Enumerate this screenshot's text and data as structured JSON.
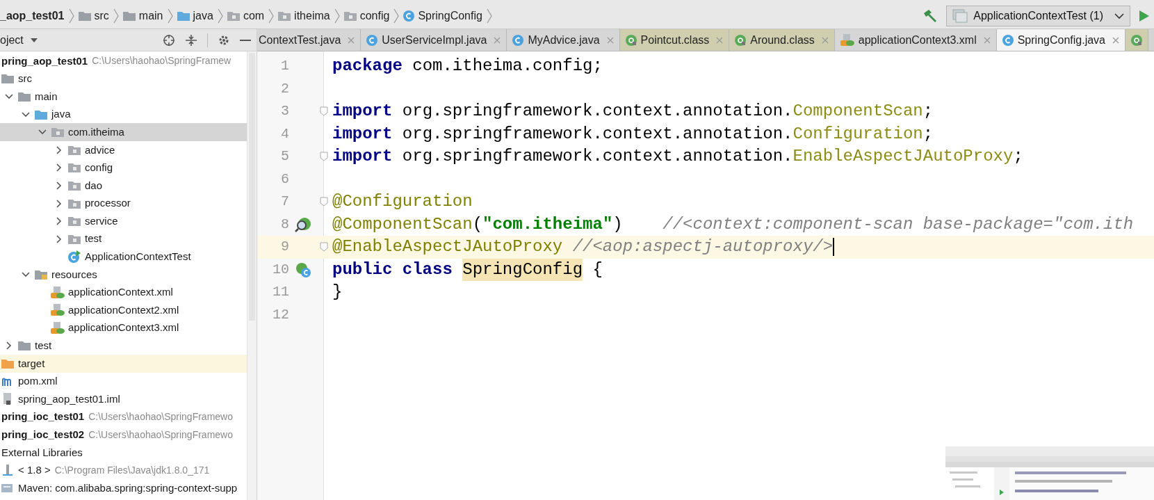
{
  "breadcrumbs": [
    {
      "label": "_aop_test01",
      "kind": "module"
    },
    {
      "label": "src",
      "kind": "folder"
    },
    {
      "label": "main",
      "kind": "folder"
    },
    {
      "label": "java",
      "kind": "source-folder"
    },
    {
      "label": "com",
      "kind": "package"
    },
    {
      "label": "itheima",
      "kind": "package"
    },
    {
      "label": "config",
      "kind": "package"
    },
    {
      "label": "SpringConfig",
      "kind": "class"
    }
  ],
  "run_config": {
    "label": "ApplicationContextTest (1)"
  },
  "project_panel": {
    "title": "oject"
  },
  "tabs": [
    {
      "label": "ContextTest.java",
      "kind": "text",
      "selected": false
    },
    {
      "label": "UserServiceImpl.java",
      "kind": "class",
      "selected": false
    },
    {
      "label": "MyAdvice.java",
      "kind": "class",
      "selected": false
    },
    {
      "label": "Pointcut.class",
      "kind": "compiled-annotation",
      "selected": false
    },
    {
      "label": "Around.class",
      "kind": "compiled-annotation",
      "selected": false
    },
    {
      "label": "applicationContext3.xml",
      "kind": "xml",
      "selected": false
    },
    {
      "label": "SpringConfig.java",
      "kind": "class",
      "selected": true
    },
    {
      "kind": "compiled-annotation",
      "selected": false
    }
  ],
  "tree": [
    {
      "label": "pring_aop_test01",
      "kind": "module",
      "detail": "C:\\Users\\haohao\\SpringFramew",
      "selected": false,
      "children": [
        {
          "label": "src",
          "kind": "folder",
          "selected": false,
          "children": [
            {
              "label": "main",
              "kind": "folder",
              "expanded": true,
              "selected": false,
              "children": [
                {
                  "label": "java",
                  "kind": "source-folder",
                  "expanded": true,
                  "selected": false,
                  "children": [
                    {
                      "label": "com.itheima",
                      "kind": "package",
                      "expanded": true,
                      "selected": true,
                      "children": [
                        {
                          "label": "advice",
                          "kind": "package",
                          "expanded": false,
                          "selected": false
                        },
                        {
                          "label": "config",
                          "kind": "package",
                          "expanded": false,
                          "selected": false
                        },
                        {
                          "label": "dao",
                          "kind": "package",
                          "expanded": false,
                          "selected": false
                        },
                        {
                          "label": "processor",
                          "kind": "package",
                          "expanded": false,
                          "selected": false
                        },
                        {
                          "label": "service",
                          "kind": "package",
                          "expanded": false,
                          "selected": false
                        },
                        {
                          "label": "test",
                          "kind": "package",
                          "expanded": false,
                          "selected": false
                        },
                        {
                          "label": "ApplicationContextTest",
                          "kind": "test-class",
                          "selected": false
                        }
                      ]
                    }
                  ]
                },
                {
                  "label": "resources",
                  "kind": "resource-folder",
                  "expanded": true,
                  "selected": false,
                  "children": [
                    {
                      "label": "applicationContext.xml",
                      "kind": "xml",
                      "selected": false
                    },
                    {
                      "label": "applicationContext2.xml",
                      "kind": "xml",
                      "selected": false
                    },
                    {
                      "label": "applicationContext3.xml",
                      "kind": "xml",
                      "selected": false
                    }
                  ]
                }
              ]
            },
            {
              "label": "test",
              "kind": "folder",
              "expanded": false,
              "selected": false
            }
          ]
        },
        {
          "label": "target",
          "kind": "excluded-folder",
          "selected": false
        },
        {
          "label": "pom.xml",
          "kind": "maven",
          "selected": false
        },
        {
          "label": "spring_aop_test01.iml",
          "kind": "iml",
          "selected": false
        }
      ]
    },
    {
      "label": "pring_ioc_test01",
      "kind": "module",
      "detail": "C:\\Users\\haohao\\SpringFramewo",
      "selected": false
    },
    {
      "label": "pring_ioc_test02",
      "kind": "module",
      "detail": "C:\\Users\\haohao\\SpringFramewo",
      "selected": false
    },
    {
      "label": "External Libraries",
      "kind": "libraries",
      "selected": false,
      "children": [
        {
          "label": "< 1.8 >",
          "kind": "jdk",
          "detail": "C:\\Program Files\\Java\\jdk1.8.0_171",
          "selected": false
        },
        {
          "label": "Maven: com.alibaba.spring:spring-context-supp",
          "kind": "library",
          "selected": false
        }
      ]
    }
  ],
  "editor": {
    "lines": [
      {
        "number": "1",
        "tokens": [
          {
            "kind": "keyword",
            "t": "package"
          },
          {
            "kind": "plain",
            "t": " com.itheima.config;"
          }
        ]
      },
      {
        "number": "2"
      },
      {
        "number": "3",
        "foldable": true,
        "tokens": [
          {
            "kind": "keyword",
            "t": "import"
          },
          {
            "kind": "plain",
            "t": " org.springframework.context.annotation."
          },
          {
            "kind": "class",
            "t": "ComponentScan"
          },
          {
            "kind": "plain",
            "t": ";"
          }
        ]
      },
      {
        "number": "4",
        "tokens": [
          {
            "kind": "keyword",
            "t": "import"
          },
          {
            "kind": "plain",
            "t": " org.springframework.context.annotation."
          },
          {
            "kind": "class",
            "t": "Configuration"
          },
          {
            "kind": "plain",
            "t": ";"
          }
        ]
      },
      {
        "number": "5",
        "foldable": true,
        "tokens": [
          {
            "kind": "keyword",
            "t": "import"
          },
          {
            "kind": "plain",
            "t": " org.springframework.context.annotation."
          },
          {
            "kind": "class",
            "t": "EnableAspectJAutoProxy"
          },
          {
            "kind": "plain",
            "t": ";"
          }
        ]
      },
      {
        "number": "6"
      },
      {
        "number": "7",
        "foldable": true,
        "tokens": [
          {
            "kind": "annotation",
            "t": "@Configuration"
          }
        ]
      },
      {
        "number": "8",
        "kind": "scan",
        "tokens": [
          {
            "kind": "annotation",
            "t": "@ComponentScan"
          },
          {
            "kind": "plain",
            "t": "("
          },
          {
            "kind": "string",
            "t": "\"com.itheima\""
          },
          {
            "kind": "plain",
            "t": ")    "
          },
          {
            "kind": "comment",
            "t": "//<context:component-scan base-package=\"com.ith"
          }
        ]
      },
      {
        "number": "9",
        "foldable": true,
        "current": true,
        "caret": true,
        "tokens": [
          {
            "kind": "annotation",
            "t": "@EnableAspectJAutoProxy "
          },
          {
            "kind": "comment",
            "t": "//<aop:aspectj-autoproxy/>"
          }
        ]
      },
      {
        "number": "10",
        "kind": "bean",
        "tokens": [
          {
            "kind": "keyword",
            "t": "public class "
          },
          {
            "kind": "usage",
            "t": "SpringConfig"
          },
          {
            "kind": "plain",
            "t": " {"
          }
        ]
      },
      {
        "number": "11",
        "tokens": [
          {
            "kind": "plain",
            "t": "}"
          }
        ]
      },
      {
        "number": "12"
      }
    ]
  }
}
